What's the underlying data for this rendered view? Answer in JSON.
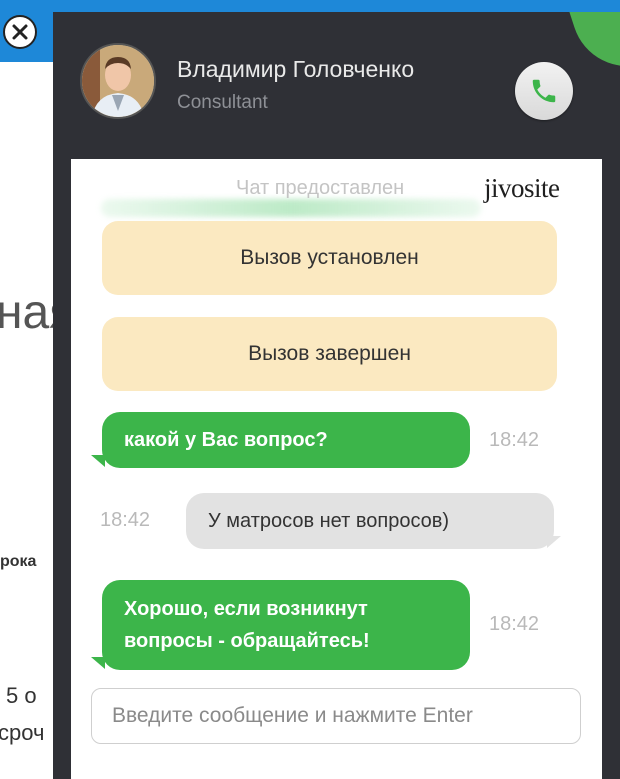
{
  "background_page": {
    "close_icon": "close-circle-icon",
    "heading_fragment": "ная",
    "bold_fragment": "рока",
    "line1_fragment": "5 о",
    "line2_fragment": "сроч"
  },
  "header": {
    "agent_name": "Владимир Головченко",
    "agent_role": "Consultant",
    "call_icon": "phone-icon"
  },
  "chat": {
    "provided_by": "Чат предоставлен",
    "brand": "jivosite",
    "system_messages": [
      "Вызов установлен",
      "Вызов завершен"
    ],
    "messages": [
      {
        "from": "agent",
        "text": "какой у Вас вопрос?",
        "time": "18:42"
      },
      {
        "from": "visitor",
        "text": "У матросов нет вопросов)",
        "time": "18:42"
      },
      {
        "from": "agent",
        "text": "Хорошо, если возникнут вопросы - обращайтесь!",
        "time": "18:42"
      }
    ],
    "input_placeholder": "Введите сообщение и нажмите Enter"
  },
  "colors": {
    "header_bg": "#2f3036",
    "agent_bubble": "#3cb54a",
    "visitor_bubble": "#e2e2e2",
    "system_bubble": "#fbe9c1",
    "page_top_bar": "#1e88d8"
  }
}
